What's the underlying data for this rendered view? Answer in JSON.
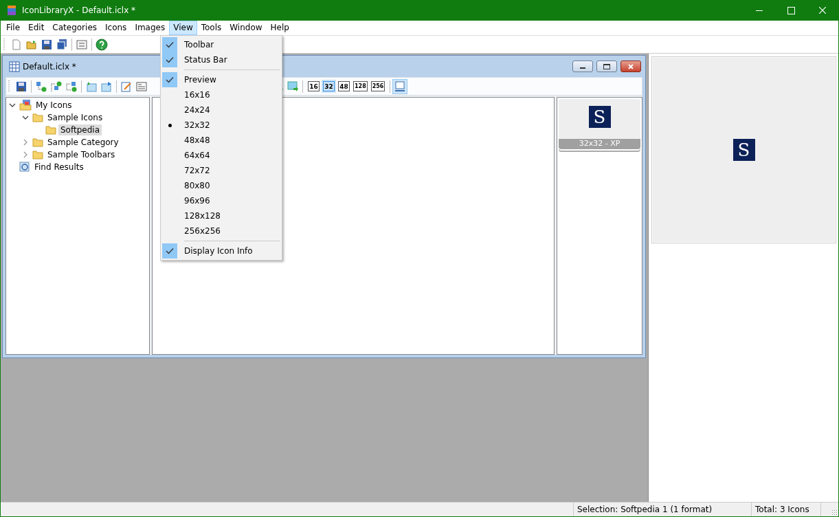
{
  "window": {
    "title": "IconLibraryX - Default.iclx *"
  },
  "menu_bar": [
    {
      "label": "File",
      "selected": false
    },
    {
      "label": "Edit",
      "selected": false
    },
    {
      "label": "Categories",
      "selected": false
    },
    {
      "label": "Icons",
      "selected": false
    },
    {
      "label": "Images",
      "selected": false
    },
    {
      "label": "View",
      "selected": true
    },
    {
      "label": "Tools",
      "selected": false
    },
    {
      "label": "Window",
      "selected": false
    },
    {
      "label": "Help",
      "selected": false
    }
  ],
  "document": {
    "title": "Default.iclx *",
    "size_buttons": [
      {
        "label": "16",
        "selected": false
      },
      {
        "label": "32",
        "selected": true
      },
      {
        "label": "48",
        "selected": false
      },
      {
        "label": "128",
        "selected": false
      },
      {
        "label": "256",
        "selected": false
      }
    ],
    "preview_toggle": {
      "selected": true
    },
    "tree": [
      {
        "label": "My Icons",
        "kind": "library",
        "expanded": true,
        "selected": false,
        "children": [
          {
            "label": "Sample Icons",
            "kind": "folder",
            "expanded": true,
            "selected": false,
            "children": [
              {
                "label": "Softpedia",
                "kind": "folder",
                "selected": true
              }
            ]
          },
          {
            "label": "Sample Category",
            "kind": "folder",
            "expanded": false,
            "selected": false
          },
          {
            "label": "Sample Toolbars",
            "kind": "folder",
            "expanded": false,
            "selected": false
          }
        ]
      },
      {
        "label": "Find Results",
        "kind": "search",
        "selected": false
      }
    ],
    "formats": [
      {
        "glyph": "S",
        "label": "32x32 - XP"
      }
    ]
  },
  "preview": {
    "glyph": "S"
  },
  "view_menu": [
    {
      "kind": "check",
      "label": "Toolbar",
      "checked": true
    },
    {
      "kind": "check",
      "label": "Status Bar",
      "checked": true
    },
    {
      "kind": "separator"
    },
    {
      "kind": "check",
      "label": "Preview",
      "checked": true
    },
    {
      "kind": "radio",
      "label": "16x16",
      "selected": false
    },
    {
      "kind": "radio",
      "label": "24x24",
      "selected": false
    },
    {
      "kind": "radio",
      "label": "32x32",
      "selected": true
    },
    {
      "kind": "radio",
      "label": "48x48",
      "selected": false
    },
    {
      "kind": "radio",
      "label": "64x64",
      "selected": false
    },
    {
      "kind": "radio",
      "label": "72x72",
      "selected": false
    },
    {
      "kind": "radio",
      "label": "80x80",
      "selected": false
    },
    {
      "kind": "radio",
      "label": "96x96",
      "selected": false
    },
    {
      "kind": "radio",
      "label": "128x128",
      "selected": false
    },
    {
      "kind": "radio",
      "label": "256x256",
      "selected": false
    },
    {
      "kind": "separator"
    },
    {
      "kind": "check",
      "label": "Display Icon Info",
      "checked": true
    }
  ],
  "status_bar": [
    "Selection: Softpedia 1 (1 format)",
    "Total: 3 Icons"
  ]
}
